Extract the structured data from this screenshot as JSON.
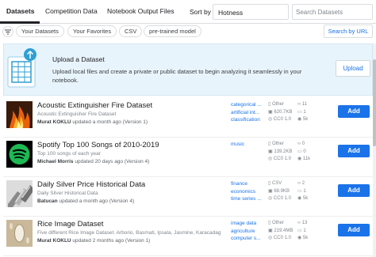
{
  "tabs": [
    "Datasets",
    "Competition Data",
    "Notebook Output Files"
  ],
  "sort": {
    "label": "Sort by",
    "value": "Hotness"
  },
  "search": {
    "placeholder": "Search Datasets"
  },
  "chips": [
    "Your Datasets",
    "Your Favorites",
    "CSV",
    "pre-trained model"
  ],
  "search_url": "Search by URL",
  "upload": {
    "title": "Upload a Dataset",
    "description": "Upload local files and create a private or public dataset to begin analyzing it seamlessly in your notebook.",
    "button": "Upload"
  },
  "datasets": [
    {
      "title": "Acoustic Extinguisher Fire Dataset",
      "subtitle": "Acoustic Extinguisher Fire Dataset",
      "author": "Murat KOKLU",
      "updated": " updated a month ago (Version 1)",
      "tags": [
        "categorical ...",
        "artificial int...",
        "classification"
      ],
      "stats": [
        "Other",
        "620.7KB",
        "CC0 1.0"
      ],
      "stats2": [
        "11",
        "1",
        "5k"
      ],
      "add": "Add"
    },
    {
      "title": "Spotify Top 100 Songs of 2010-2019",
      "subtitle": "Top 100 songs of each year",
      "author": "Michael Morris",
      "updated": " updated 20 days ago (Version 4)",
      "tags": [
        "music"
      ],
      "stats": [
        "Other",
        "139.2KB",
        "CC0 1.0"
      ],
      "stats2": [
        "0",
        "0",
        "11k"
      ],
      "add": "Add"
    },
    {
      "title": "Daily Silver Price Historical Data",
      "subtitle": "Daily Silver Historical Data",
      "author": "Batucan",
      "updated": " updated a month ago (Version 4)",
      "tags": [
        "finance",
        "economics",
        "time series ..."
      ],
      "stats": [
        "CSV",
        "68.9KB",
        "CC0 1.0"
      ],
      "stats2": [
        "2",
        "1",
        "5k"
      ],
      "add": "Add"
    },
    {
      "title": "Rice Image Dataset",
      "subtitle": "Five different Rice Image Dataset. Arborio, Basmati, Ipsala, Jasmine, Karacadag",
      "author": "Murat KOKLU",
      "updated": " updated 2 months ago (Version 1)",
      "tags": [
        "image data",
        "agriculture",
        "computer s..."
      ],
      "stats": [
        "Other",
        "219.4MB",
        "CC0 1.0"
      ],
      "stats2": [
        "13",
        "1",
        "5k"
      ],
      "add": "Add"
    }
  ],
  "colors": {
    "accent": "#1a73e8",
    "banner_bg": "#e8f4fb"
  }
}
